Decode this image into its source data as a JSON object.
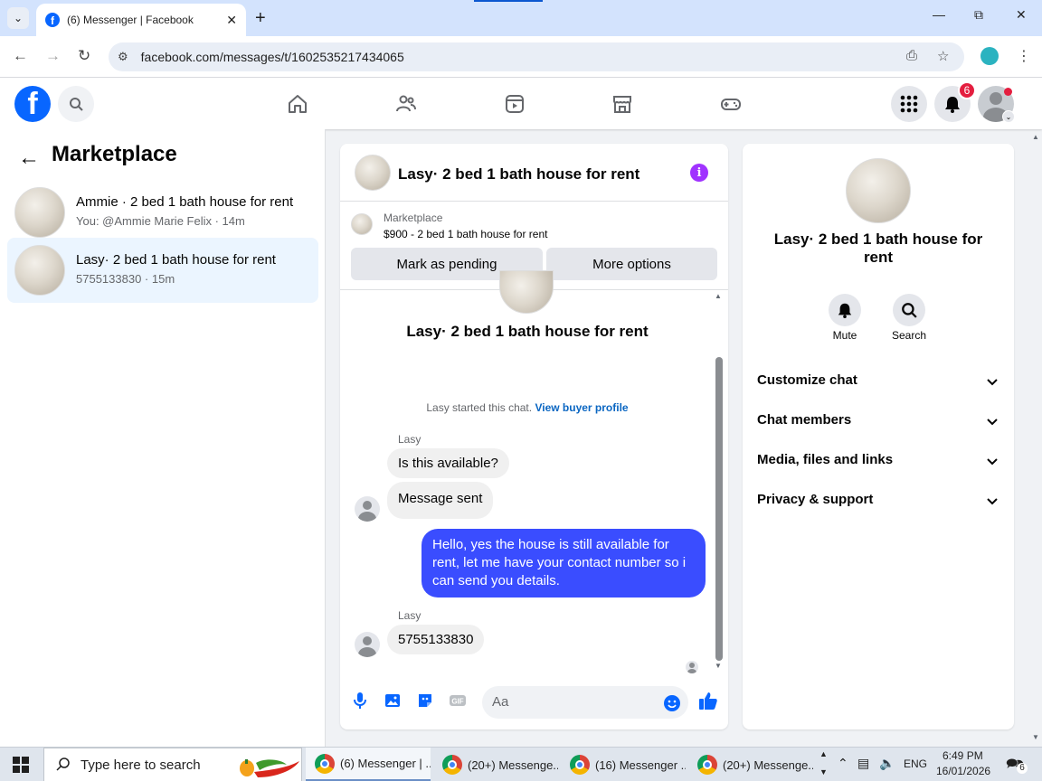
{
  "browser": {
    "tab_title": "(6) Messenger | Facebook",
    "url": "facebook.com/messages/t/1602535217434065"
  },
  "fbnav": {
    "notification_count": "6"
  },
  "left_panel": {
    "title": "Marketplace",
    "conversations": [
      {
        "title": "Ammie · 2 bed 1 bath house for rent",
        "subtitle": "You: @Ammie Marie Felix · 14m"
      },
      {
        "title": "Lasy· 2 bed 1 bath house for rent",
        "subtitle": "5755133830 · 15m"
      }
    ]
  },
  "chat": {
    "header_title": "Lasy· 2 bed 1 bath house for rent",
    "marketplace_label": "Marketplace",
    "listing": "$900 - 2 bed 1 bath house for rent",
    "mark_pending": "Mark as pending",
    "more_options": "More options",
    "intro_title": "Lasy· 2 bed 1 bath house for rent",
    "started_text": "Lasy started this chat.",
    "view_buyer_profile": "View buyer profile",
    "messages": [
      {
        "sender": "Lasy",
        "text": "Is this available?"
      },
      {
        "text": "Message sent"
      },
      {
        "text": "Hello, yes the house is still available for rent, let me have your contact number so i can send you details."
      },
      {
        "sender": "Lasy",
        "text": "5755133830"
      }
    ],
    "composer_placeholder": "Aa"
  },
  "right_panel": {
    "title": "Lasy· 2 bed 1 bath house for rent",
    "mute": "Mute",
    "search": "Search",
    "rows": [
      "Customize chat",
      "Chat members",
      "Media, files and links",
      "Privacy & support"
    ]
  },
  "taskbar": {
    "search_placeholder": "Type here to search",
    "apps": [
      "(6) Messenger | ...",
      "(20+) Messenge...",
      "(16) Messenger ...",
      "(20+) Messenge..."
    ],
    "lang": "ENG",
    "time": "6:49 PM",
    "date": "16/01/2026",
    "notif_count": "6"
  },
  "colors": {
    "fb_blue": "#0866ff",
    "outgoing_bubble": "#3a4dff",
    "notif_red": "#e41e3f",
    "info_purple": "#a033ff"
  }
}
